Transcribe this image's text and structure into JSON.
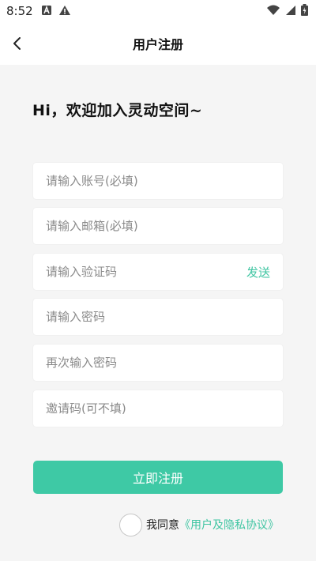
{
  "status_bar": {
    "time": "8:52",
    "icons": [
      "notification-a-icon",
      "warning-icon",
      "wifi-icon",
      "signal-icon",
      "battery-icon"
    ]
  },
  "header": {
    "title": "用户注册",
    "back_icon": "chevron-left-icon"
  },
  "greeting": "Hi，欢迎加入灵动空间~",
  "form": {
    "account_placeholder": "请输入账号(必填)",
    "email_placeholder": "请输入邮箱(必填)",
    "code_placeholder": "请输入验证码",
    "send_label": "发送",
    "password_placeholder": "请输入密码",
    "confirm_password_placeholder": "再次输入密码",
    "invite_placeholder": "邀请码(可不填)"
  },
  "submit_label": "立即注册",
  "agreement": {
    "prefix": "我同意",
    "link": "《用户及隐私协议》"
  },
  "colors": {
    "accent": "#3ec9a5",
    "background": "#f5f5f5",
    "card": "#ffffff"
  }
}
